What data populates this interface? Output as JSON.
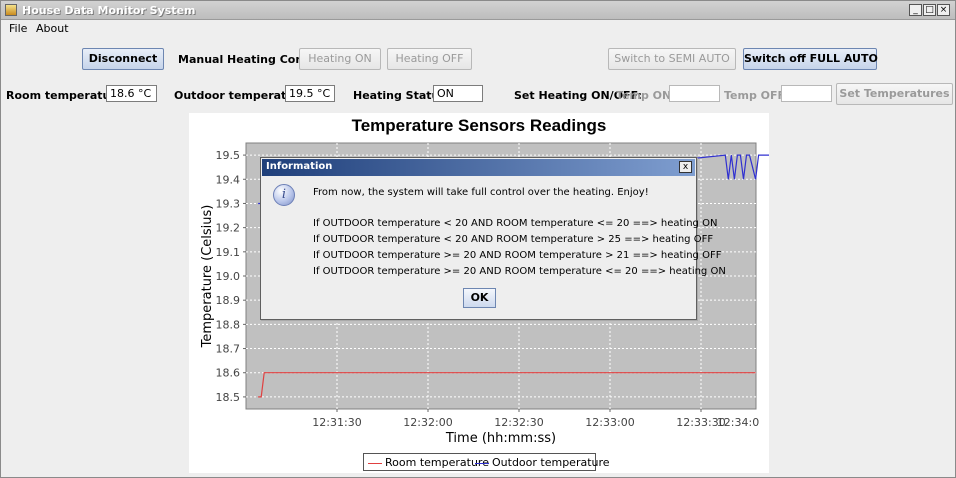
{
  "window": {
    "title": "House Data Monitor System"
  },
  "menu": {
    "file": "File",
    "about": "About"
  },
  "toolbar": {
    "disconnect": "Disconnect",
    "manual_label": "Manual Heating Control:",
    "heating_on": "Heating ON",
    "heating_off": "Heating OFF",
    "semi_auto": "Switch to SEMI AUTO",
    "full_auto": "Switch off FULL AUTO"
  },
  "status_row": {
    "room_label": "Room temperature:",
    "room_value": "18.6 °C",
    "outdoor_label": "Outdoor temperature:",
    "outdoor_value": "19.5 °C",
    "heating_label": "Heating Status:",
    "heating_value": "ON",
    "set_label": "Set Heating ON/OFF:",
    "temp_on_label": "Temp ON:",
    "temp_on_value": "",
    "temp_off_label": "Temp OFF:",
    "temp_off_value": "",
    "set_button": "Set Temperatures"
  },
  "chart_data": {
    "type": "line",
    "title": "Temperature Sensors Readings",
    "xlabel": "Time (hh:mm:ss)",
    "ylabel": "Temperature (Celsius)",
    "ylim": [
      18.45,
      19.55
    ],
    "y_ticks": [
      "18.5",
      "18.6",
      "18.7",
      "18.8",
      "18.9",
      "19.0",
      "19.1",
      "19.2",
      "19.3",
      "19.4",
      "19.5"
    ],
    "x_range_seconds": [
      0,
      155
    ],
    "x_ticks": [
      {
        "label": "12:31:30",
        "t": 30
      },
      {
        "label": "12:32:00",
        "t": 60
      },
      {
        "label": "12:32:30",
        "t": 90
      },
      {
        "label": "12:33:00",
        "t": 120
      },
      {
        "label": "12:33:30",
        "t": 150
      },
      {
        "label": "12:34:0",
        "t": 180
      }
    ],
    "grid": true,
    "legend_position": "bottom",
    "series": [
      {
        "name": "Room temperature",
        "color": "#e04040",
        "points": [
          [
            4,
            18.5
          ],
          [
            5,
            18.5
          ],
          [
            6,
            18.6
          ],
          [
            8,
            18.6
          ],
          [
            168,
            18.6
          ]
        ]
      },
      {
        "name": "Outdoor temperature",
        "color": "#3030d0",
        "points": [
          [
            4,
            19.3
          ],
          [
            5,
            19.3
          ],
          [
            158,
            19.5
          ],
          [
            159,
            19.4
          ],
          [
            160,
            19.5
          ],
          [
            161,
            19.4
          ],
          [
            162,
            19.5
          ],
          [
            163,
            19.5
          ],
          [
            164,
            19.4
          ],
          [
            165,
            19.5
          ],
          [
            166,
            19.5
          ],
          [
            168,
            19.4
          ],
          [
            169,
            19.5
          ],
          [
            171,
            19.5
          ],
          [
            176,
            19.5
          ],
          [
            177,
            19.4
          ],
          [
            178,
            19.5
          ],
          [
            181,
            19.5
          ]
        ]
      }
    ]
  },
  "dialog": {
    "title": "Information",
    "close": "x",
    "message": "From now, the system will take full control over the heating. Enjoy!",
    "rules": [
      "If OUTDOOR temperature < 20 AND ROOM temperature <= 20 ==> heating ON",
      "If OUTDOOR temperature < 20 AND ROOM temperature > 25 ==> heating OFF",
      "If OUTDOOR temperature >= 20 AND ROOM temperature > 21 ==> heating OFF",
      "If OUTDOOR temperature >= 20 AND ROOM temperature <= 20 ==> heating ON"
    ],
    "ok": "OK"
  }
}
